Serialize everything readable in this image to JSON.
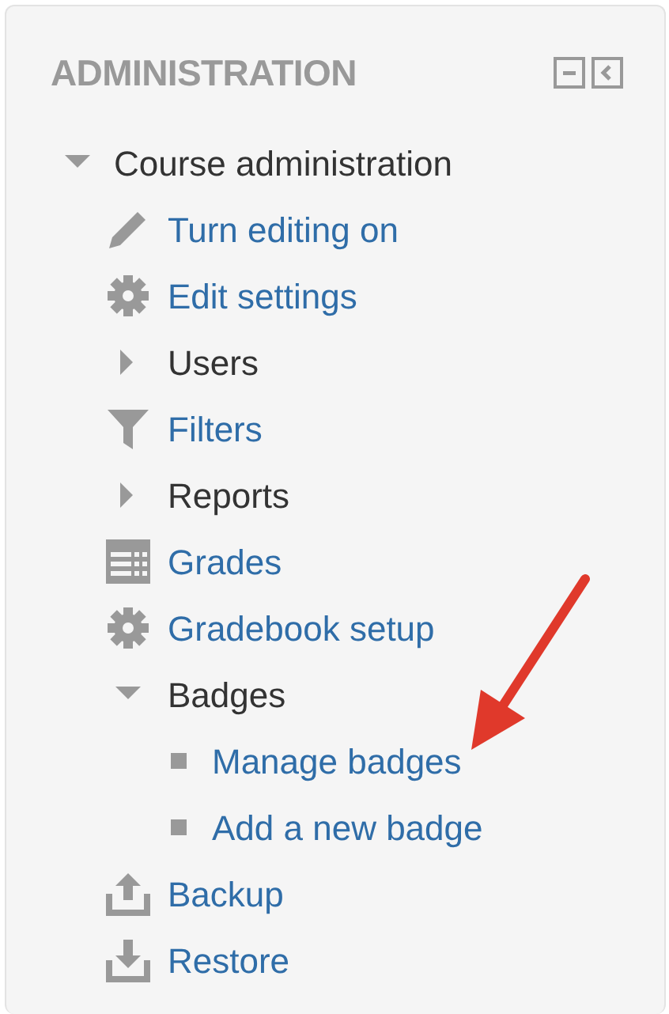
{
  "block": {
    "title": "ADMINISTRATION"
  },
  "tree": [
    {
      "label": "Course administration",
      "kind": "branch",
      "expanded": true,
      "children": [
        {
          "label": "Turn editing on",
          "kind": "link"
        },
        {
          "label": "Edit settings",
          "kind": "link"
        },
        {
          "label": "Users",
          "kind": "branch",
          "expanded": false
        },
        {
          "label": "Filters",
          "kind": "link"
        },
        {
          "label": "Reports",
          "kind": "branch",
          "expanded": false
        },
        {
          "label": "Grades",
          "kind": "link"
        },
        {
          "label": "Gradebook setup",
          "kind": "link"
        },
        {
          "label": "Badges",
          "kind": "branch",
          "expanded": true,
          "children": [
            {
              "label": "Manage badges",
              "kind": "leaf"
            },
            {
              "label": "Add a new badge",
              "kind": "leaf"
            }
          ]
        },
        {
          "label": "Backup",
          "kind": "link"
        },
        {
          "label": "Restore",
          "kind": "link"
        }
      ]
    }
  ]
}
